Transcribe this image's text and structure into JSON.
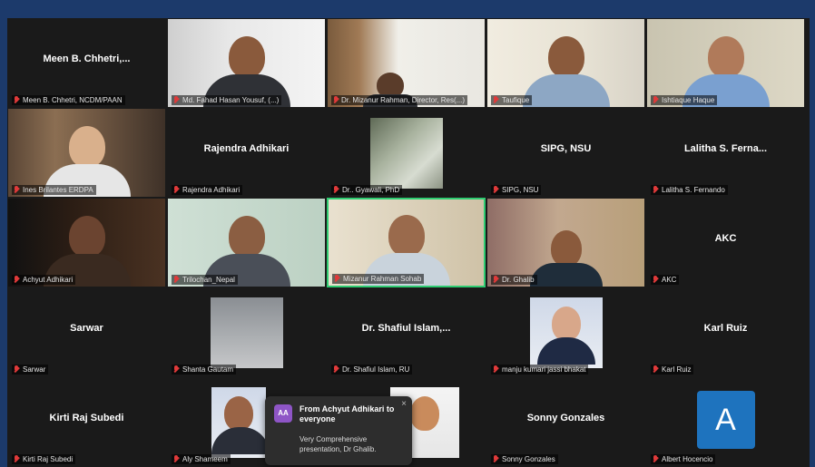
{
  "tiles": [
    {
      "name": "Meen B. Chhetri,...",
      "label": "Meen B. Chhetri, NCDM/PAAN",
      "type": "name"
    },
    {
      "name": "",
      "label": "Md. Fahad Hasan Yousuf, (...)",
      "type": "video"
    },
    {
      "name": "",
      "label": "Dr. Mizanur Rahman, Director, Res(...)",
      "type": "video"
    },
    {
      "name": "",
      "label": "Taufique",
      "type": "video"
    },
    {
      "name": "",
      "label": "Ishtiaque Haque",
      "type": "video"
    },
    {
      "name": "",
      "label": "Ines Brilantes ERDPA",
      "type": "video"
    },
    {
      "name": "Rajendra Adhikari",
      "label": "Rajendra Adhikari",
      "type": "name"
    },
    {
      "name": "",
      "label": "Dr.. Gyawali, PhD",
      "type": "photo"
    },
    {
      "name": "SIPG, NSU",
      "label": "SIPG, NSU",
      "type": "name"
    },
    {
      "name": "Lalitha S. Ferna...",
      "label": "Lalitha S. Fernando",
      "type": "name"
    },
    {
      "name": "",
      "label": "Achyut Adhikari",
      "type": "video"
    },
    {
      "name": "",
      "label": "Trilochan_Nepal",
      "type": "video"
    },
    {
      "name": "",
      "label": "Mizanur Rahman Sohab",
      "type": "video"
    },
    {
      "name": "",
      "label": "Dr. Ghalib",
      "type": "video"
    },
    {
      "name": "AKC",
      "label": "AKC",
      "type": "name"
    },
    {
      "name": "Sarwar",
      "label": "Sarwar",
      "type": "name"
    },
    {
      "name": "",
      "label": "Shanta Gautam",
      "type": "photo"
    },
    {
      "name": "Dr. Shafiul Islam,...",
      "label": "Dr. Shafiul Islam, RU",
      "type": "name"
    },
    {
      "name": "",
      "label": "manju kumari jassi bhakat",
      "type": "photo"
    },
    {
      "name": "Karl Ruiz",
      "label": "Karl Ruiz",
      "type": "name"
    },
    {
      "name": "Kirti Raj Subedi",
      "label": "Kirti Raj Subedi",
      "type": "name"
    },
    {
      "name": "",
      "label": "Aly Shameem",
      "type": "photo"
    },
    {
      "name": "",
      "label": "",
      "type": "photo"
    },
    {
      "name": "Sonny Gonzales",
      "label": "Sonny Gonzales",
      "type": "name"
    },
    {
      "name": "",
      "label": "Albert Hocencio",
      "type": "avatar"
    }
  ],
  "avatar_letter": "A",
  "chat": {
    "badge": "AA",
    "from": "From Achyut Adhikari to everyone",
    "message": "Very Comprehensive presentation, Dr Ghalib.",
    "close": "×"
  },
  "colors": {
    "active_speaker_border": "#2ecc71",
    "muted_mic": "#e03a3a",
    "background": "#1a1a1a",
    "outer": "#1c3a6b",
    "avatar_bg": "#1e73be",
    "chat_badge": "#8e55c6"
  }
}
